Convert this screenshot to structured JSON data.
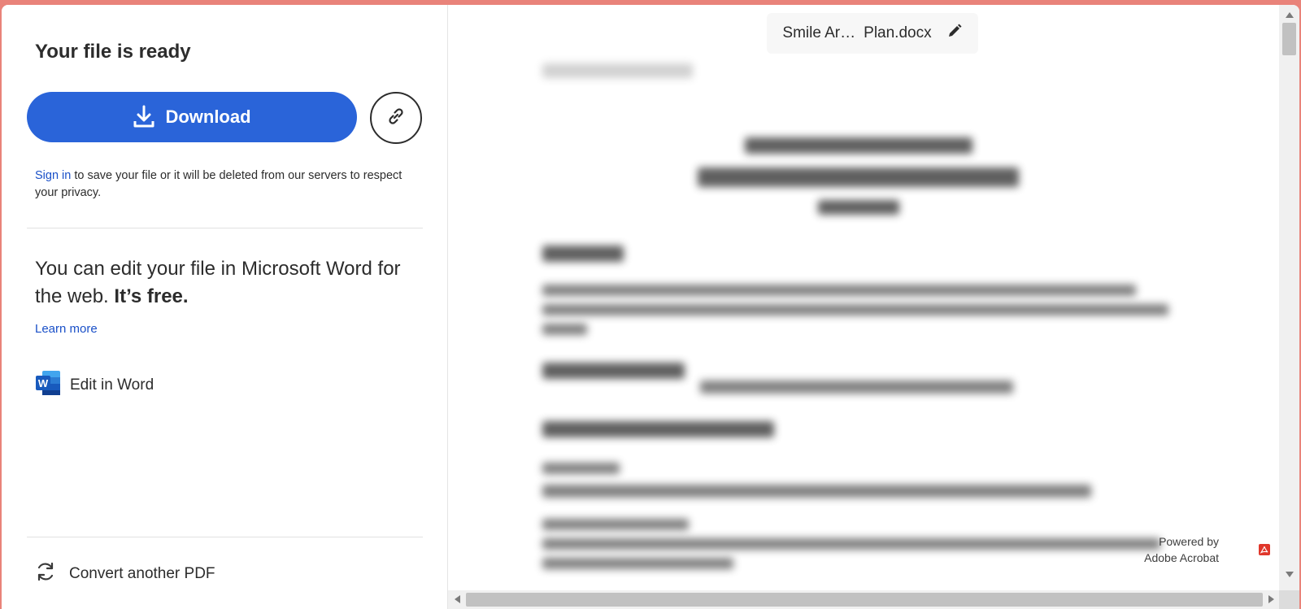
{
  "colors": {
    "accent": "#2a64d9",
    "link": "#1a50c8",
    "frame": "#e9837a",
    "word_blue": "#185abd",
    "acrobat_red": "#e0372b"
  },
  "left_panel": {
    "title": "Your file is ready",
    "download_label": "Download",
    "download_icon": "download-icon",
    "copy_link_icon": "link-icon",
    "sign_in_link": "Sign in",
    "sign_in_rest": " to save your file or it will be deleted from our servers to respect your privacy.",
    "edit_heading_plain": "You can edit your file in Microsoft Word for the web. ",
    "edit_heading_bold": "It’s free.",
    "learn_more": "Learn more",
    "edit_in_word": "Edit in Word",
    "word_icon": "word-app-icon",
    "convert_another": "Convert another PDF",
    "convert_icon": "refresh-icon"
  },
  "preview": {
    "file_name_start": "Smile Ar…",
    "file_name_end": "Plan.docx",
    "rename_icon": "pencil-icon",
    "powered_by_line1": "Powered by",
    "powered_by_line2": "Adobe Acrobat",
    "acrobat_icon": "acrobat-icon"
  }
}
